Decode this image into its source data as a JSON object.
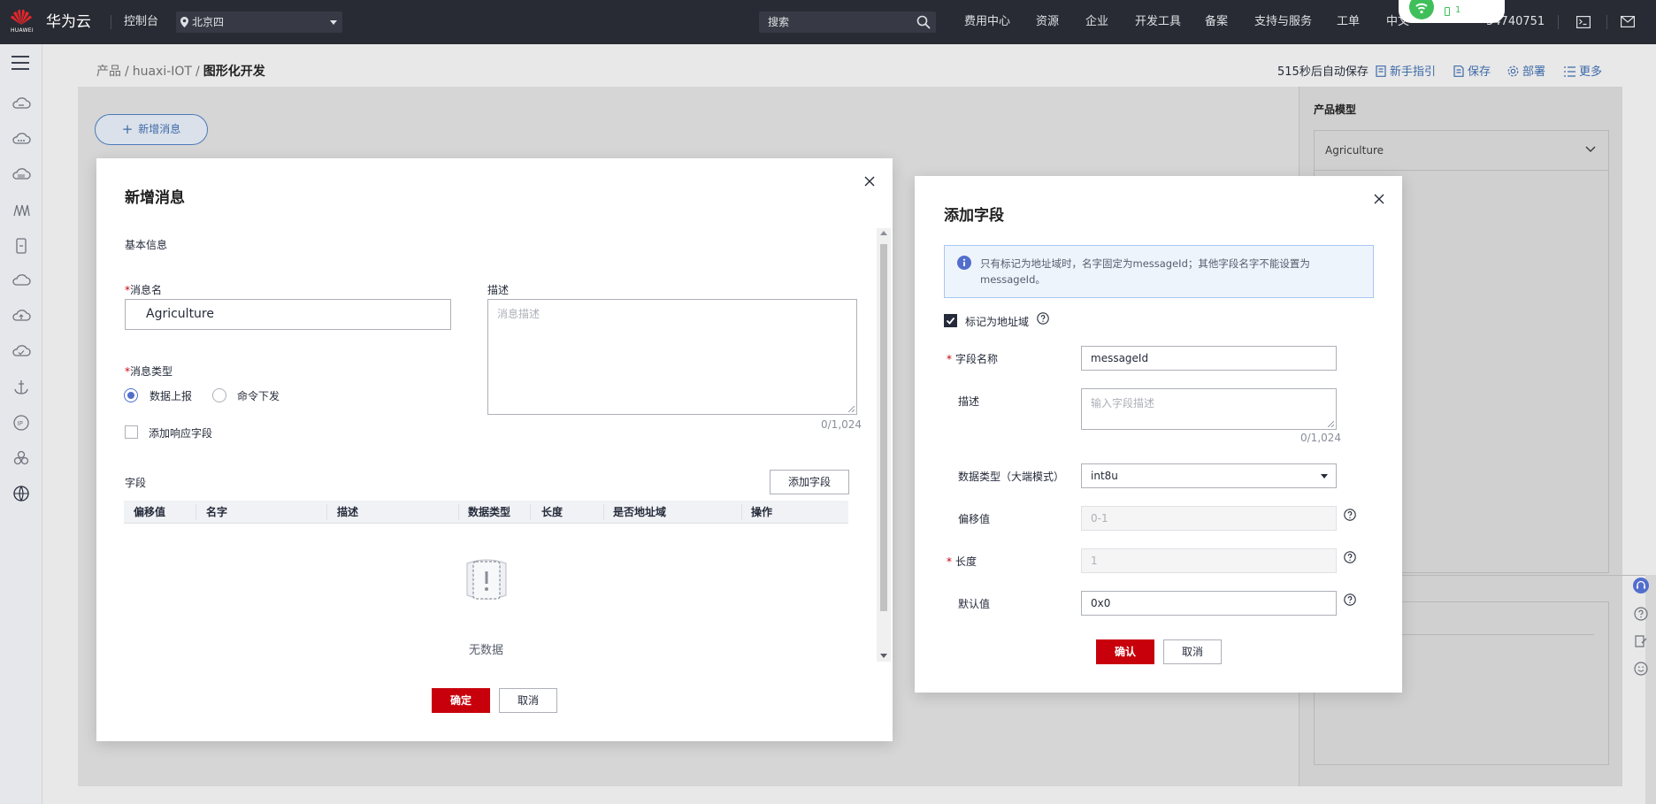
{
  "topbar": {
    "brand": "华为云",
    "logo_text": "HUAWEI",
    "console": "控制台",
    "region": "北京四",
    "search_placeholder": "搜索",
    "nav": [
      "费用中心",
      "资源",
      "企业",
      "开发工具",
      "备案",
      "支持与服务",
      "工单",
      "中文",
      "54740751"
    ],
    "wifi_badge": "1"
  },
  "breadcrumb": {
    "items": [
      "产品",
      "huaxi-IOT"
    ],
    "current": "图形化开发"
  },
  "toolbar": {
    "autosave": "515秒后自动保存",
    "guide": "新手指引",
    "save": "保存",
    "deploy": "部署",
    "more": "更多"
  },
  "canvas": {
    "add_message_button": "新增消息"
  },
  "right_panel": {
    "title": "产品模型",
    "selected_model": "Agriculture"
  },
  "message_dialog": {
    "title": "新增消息",
    "section_basic": "基本信息",
    "name_label": "消息名",
    "name_value": "Agriculture",
    "desc_label": "描述",
    "desc_placeholder": "消息描述",
    "desc_counter": "0/1,024",
    "type_label": "消息类型",
    "type_options": [
      "数据上报",
      "命令下发"
    ],
    "type_selected": "数据上报",
    "add_response_label": "添加响应字段",
    "fields_label": "字段",
    "add_field_button": "添加字段",
    "table_headers": [
      "偏移值",
      "名字",
      "描述",
      "数据类型",
      "长度",
      "是否地址域",
      "操作"
    ],
    "table_rows": [],
    "empty_text": "无数据",
    "confirm": "确定",
    "cancel": "取消"
  },
  "field_dialog": {
    "title": "添加字段",
    "info": "只有标记为地址域时，名字固定为messageId；其他字段名字不能设置为messageId。",
    "mark_address_label": "标记为地址域",
    "mark_address_checked": true,
    "name_label": "字段名称",
    "name_value": "messageId",
    "desc_label": "描述",
    "desc_placeholder": "输入字段描述",
    "desc_counter": "0/1,024",
    "type_label": "数据类型（大端模式）",
    "type_value": "int8u",
    "offset_label": "偏移值",
    "offset_value": "0-1",
    "length_label": "长度",
    "length_value": "1",
    "default_label": "默认值",
    "default_value": "0x0",
    "confirm": "确认",
    "cancel": "取消"
  },
  "colors": {
    "topbar": "#282b33",
    "primary_red": "#c7000b",
    "link_blue": "#3d6aa8",
    "radio_blue": "#526ecc"
  }
}
